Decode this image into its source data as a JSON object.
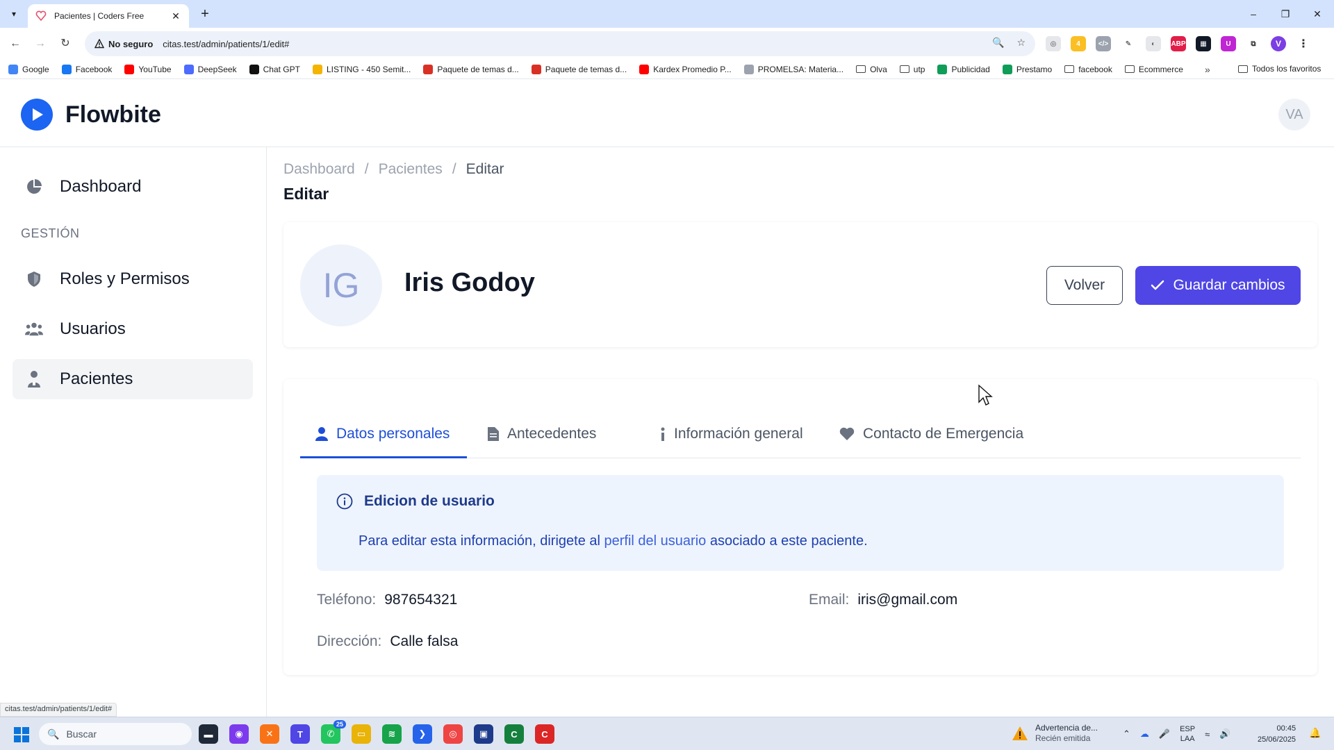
{
  "browser": {
    "tab_title": "Pacientes | Coders Free",
    "new_tab": "+",
    "security_label": "No seguro",
    "url": "citas.test/admin/patients/1/edit#",
    "status_url": "citas.test/admin/patients/1/edit#",
    "profile_initial": "V",
    "bookmarks": [
      {
        "label": "Google",
        "color": "#4285f4"
      },
      {
        "label": "Facebook",
        "color": "#1877f2"
      },
      {
        "label": "YouTube",
        "color": "#ff0000"
      },
      {
        "label": "DeepSeek",
        "color": "#4d6bfe"
      },
      {
        "label": "Chat GPT",
        "color": "#111111"
      },
      {
        "label": "LISTING - 450 Semit...",
        "color": "#f4b400"
      },
      {
        "label": "Paquete de temas d...",
        "color": "#d93025"
      },
      {
        "label": "Paquete de temas d...",
        "color": "#d93025"
      },
      {
        "label": "Kardex Promedio P...",
        "color": "#ff0000"
      },
      {
        "label": "PROMELSA: Materia...",
        "color": "#9ca3af"
      },
      {
        "label": "Olva",
        "color": "folder"
      },
      {
        "label": "utp",
        "color": "folder"
      },
      {
        "label": "Publicidad",
        "color": "#0f9d58"
      },
      {
        "label": "Prestamo",
        "color": "#0f9d58"
      },
      {
        "label": "facebook",
        "color": "folder"
      },
      {
        "label": "Ecommerce",
        "color": "folder"
      }
    ],
    "bookmarks_more": "»",
    "all_bookmarks": "Todos los favoritos"
  },
  "header": {
    "brand": "Flowbite",
    "user_initials": "VA"
  },
  "sidebar": {
    "items": [
      {
        "label": "Dashboard",
        "icon": "pie-chart-icon"
      },
      {
        "label": "Roles y Permisos",
        "icon": "shield-icon"
      },
      {
        "label": "Usuarios",
        "icon": "users-icon"
      },
      {
        "label": "Pacientes",
        "icon": "patient-icon"
      }
    ],
    "section_label": "GESTIÓN",
    "active": "Pacientes"
  },
  "breadcrumb": {
    "items": [
      "Dashboard",
      "Pacientes",
      "Editar"
    ],
    "separator": "/"
  },
  "page_title": "Editar",
  "patient": {
    "initials": "IG",
    "name": "Iris Godoy"
  },
  "actions": {
    "back": "Volver",
    "save": "Guardar cambios"
  },
  "tabs": [
    {
      "label": "Datos personales",
      "icon": "user-icon",
      "active": true
    },
    {
      "label": "Antecedentes",
      "icon": "document-icon",
      "active": false
    },
    {
      "label": "Información general",
      "icon": "info-icon",
      "active": false
    },
    {
      "label": "Contacto de Emergencia",
      "icon": "heart-icon",
      "active": false
    }
  ],
  "alert": {
    "title": "Edicion de usuario",
    "body_prefix": "Para editar esta información, dirigete al ",
    "link": "perfil del usuario",
    "body_suffix": " asociado a este paciente."
  },
  "fields": {
    "phone_label": "Teléfono:",
    "phone_value": "987654321",
    "email_label": "Email:",
    "email_value": "iris@gmail.com",
    "address_label": "Dirección:",
    "address_value": "Calle falsa"
  },
  "taskbar": {
    "search_placeholder": "Buscar",
    "whatsapp_badge": "25",
    "warning_title": "Advertencia de...",
    "warning_sub": "Recién emitida",
    "lang_top": "ESP",
    "lang_bottom": "LAA",
    "time": "00:45",
    "date": "25/06/2025"
  },
  "colors": {
    "accent": "#4f46e5",
    "tab_active": "#1d4ed8",
    "alert_bg": "#eef4fe"
  }
}
